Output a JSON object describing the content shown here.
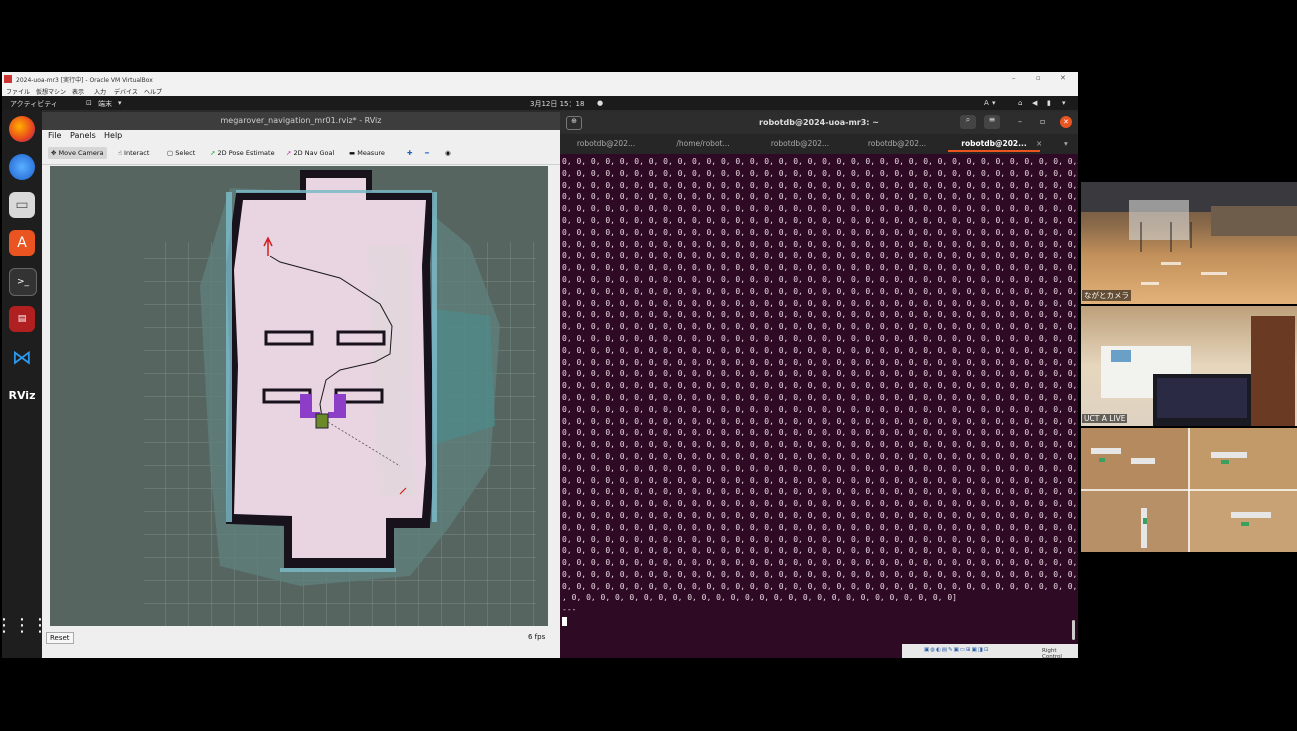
{
  "vbox": {
    "title": "2024-uoa-mr3 [実行中] - Oracle VM VirtualBox",
    "menu": [
      "ファイル",
      "仮想マシン",
      "表示",
      "入力",
      "デバイス",
      "ヘルプ"
    ]
  },
  "topbar": {
    "activities": "アクティビティ",
    "app": "端末",
    "clock": "3月12日 15：18",
    "input_method": "A"
  },
  "rviz": {
    "title": "megarover_navigation_mr01.rviz* - RViz",
    "menu": [
      "File",
      "Panels",
      "Help"
    ],
    "tools": [
      "Move Camera",
      "Interact",
      "Select",
      "2D Pose Estimate",
      "2D Nav Goal",
      "Measure"
    ],
    "reset_label": "Reset",
    "fps": "6 fps"
  },
  "terminal": {
    "title": "robotdb@2024-uoa-mr3: ~",
    "tabs": [
      "robotdb@202...",
      "/home/robot...",
      "robotdb@202...",
      "robotdb@202...",
      "robotdb@202..."
    ],
    "active_tab": 4,
    "last_line": ", 0, 0, 0, 0, 0, 0, 0, 0, 0, 0, 0, 0, 0, 0, 0, 0, 0, 0, 0, 0, 0, 0, 0, 0, 0, 0, 0]",
    "ellipsis": "---"
  },
  "systray": {
    "host_key": "Right Control"
  },
  "cameras": [
    {
      "label": "ながとカメラ"
    },
    {
      "label": "UCT A LIVE"
    },
    {
      "label": ""
    }
  ],
  "colors": {
    "terminal_bg": "#2f0a24",
    "map_free": "#e9d4e2",
    "map_unknown": "#5a6a66",
    "accent": "#e95420"
  }
}
